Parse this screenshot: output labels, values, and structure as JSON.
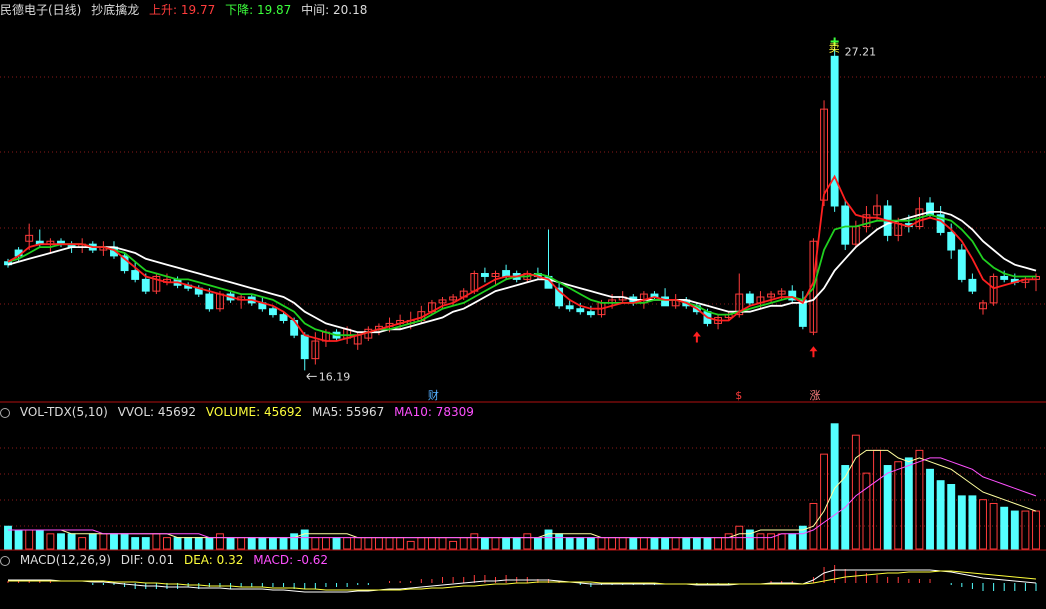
{
  "main_header": {
    "title": "民德电子(日线)",
    "indicator": "抄底擒龙",
    "up_label": "上升: 19.77",
    "down_label": "下降: 19.87",
    "mid_label": "中间: 20.18"
  },
  "vol_header": {
    "name": "VOL-TDX(5,10)",
    "vvol": "VVOL: 45692",
    "volume": "VOLUME: 45692",
    "ma5": "MA5: 55967",
    "ma10": "MA10: 78309"
  },
  "macd_header": {
    "name": "MACD(12,26,9)",
    "dif": "DIF: 0.01",
    "dea": "DEA: 0.32",
    "macd": "MACD: -0.62"
  },
  "annotations": {
    "high_price": "27.21",
    "low_price": "16.19",
    "sell_mark": "卖",
    "event_cai": "财",
    "event_s": "$",
    "event_zhang": "涨"
  },
  "colors": {
    "up": "#ff3c3c",
    "down": "#54ffff",
    "ma_red": "#ff2020",
    "ma_green": "#20d020",
    "ma_white": "#ffffff",
    "vol_ma5": "#ffffa0",
    "vol_ma10": "#ff50ff"
  },
  "chart_data": {
    "type": "candlestick",
    "ylim": [
      15.6,
      28.0
    ],
    "candles": [
      [
        19.9,
        20.0,
        19.7,
        19.8
      ],
      [
        20.3,
        20.4,
        19.9,
        20.1
      ],
      [
        20.6,
        21.2,
        20.3,
        20.8
      ],
      [
        20.6,
        21.0,
        20.4,
        20.5
      ],
      [
        20.5,
        20.7,
        20.2,
        20.6
      ],
      [
        20.6,
        20.7,
        20.4,
        20.5
      ],
      [
        20.5,
        20.6,
        20.2,
        20.4
      ],
      [
        20.4,
        20.7,
        20.2,
        20.5
      ],
      [
        20.5,
        20.6,
        20.2,
        20.3
      ],
      [
        20.3,
        20.6,
        20.1,
        20.4
      ],
      [
        20.4,
        20.6,
        20.0,
        20.1
      ],
      [
        20.1,
        20.2,
        19.5,
        19.6
      ],
      [
        19.6,
        19.9,
        19.2,
        19.3
      ],
      [
        19.3,
        19.5,
        18.8,
        18.9
      ],
      [
        18.9,
        19.5,
        18.8,
        19.4
      ],
      [
        19.2,
        19.5,
        19.1,
        19.3
      ],
      [
        19.3,
        19.4,
        19.0,
        19.1
      ],
      [
        19.1,
        19.2,
        18.9,
        19.0
      ],
      [
        19.0,
        19.1,
        18.7,
        18.8
      ],
      [
        18.8,
        19.0,
        18.2,
        18.3
      ],
      [
        18.3,
        18.9,
        18.2,
        18.8
      ],
      [
        18.8,
        18.9,
        18.5,
        18.6
      ],
      [
        18.6,
        18.8,
        18.3,
        18.7
      ],
      [
        18.7,
        18.8,
        18.4,
        18.5
      ],
      [
        18.5,
        18.7,
        18.2,
        18.3
      ],
      [
        18.3,
        18.4,
        18.0,
        18.1
      ],
      [
        18.1,
        18.2,
        17.8,
        17.9
      ],
      [
        17.9,
        18.0,
        17.3,
        17.4
      ],
      [
        17.4,
        17.5,
        16.2,
        16.6
      ],
      [
        16.6,
        17.5,
        16.4,
        17.2
      ],
      [
        17.2,
        17.6,
        17.0,
        17.5
      ],
      [
        17.5,
        17.6,
        17.2,
        17.3
      ],
      [
        17.3,
        17.7,
        17.1,
        17.6
      ],
      [
        17.1,
        17.5,
        16.9,
        17.4
      ],
      [
        17.3,
        17.7,
        17.2,
        17.6
      ],
      [
        17.6,
        17.8,
        17.4,
        17.7
      ],
      [
        17.7,
        18.0,
        17.5,
        17.8
      ],
      [
        17.8,
        18.1,
        17.6,
        17.9
      ],
      [
        17.8,
        18.2,
        17.6,
        17.9
      ],
      [
        17.9,
        18.4,
        17.8,
        18.2
      ],
      [
        18.2,
        18.6,
        18.1,
        18.5
      ],
      [
        18.5,
        18.7,
        18.3,
        18.6
      ],
      [
        18.6,
        18.8,
        18.4,
        18.7
      ],
      [
        18.7,
        19.0,
        18.6,
        18.9
      ],
      [
        18.9,
        19.6,
        18.8,
        19.5
      ],
      [
        19.5,
        19.7,
        19.2,
        19.4
      ],
      [
        19.4,
        19.6,
        19.1,
        19.5
      ],
      [
        19.6,
        19.8,
        19.3,
        19.4
      ],
      [
        19.5,
        19.6,
        19.2,
        19.3
      ],
      [
        19.3,
        19.6,
        19.2,
        19.5
      ],
      [
        19.5,
        19.7,
        19.3,
        19.4
      ],
      [
        19.4,
        21.0,
        19.3,
        19.0
      ],
      [
        19.0,
        19.2,
        18.3,
        18.4
      ],
      [
        18.4,
        18.6,
        18.2,
        18.3
      ],
      [
        18.3,
        18.5,
        18.1,
        18.2
      ],
      [
        18.2,
        18.4,
        18.0,
        18.1
      ],
      [
        18.1,
        18.6,
        18.0,
        18.5
      ],
      [
        18.5,
        18.8,
        18.3,
        18.6
      ],
      [
        18.6,
        18.9,
        18.5,
        18.7
      ],
      [
        18.7,
        18.8,
        18.4,
        18.5
      ],
      [
        18.5,
        18.9,
        18.3,
        18.8
      ],
      [
        18.8,
        18.9,
        18.6,
        18.7
      ],
      [
        18.7,
        19.0,
        18.5,
        18.4
      ],
      [
        18.4,
        18.8,
        18.3,
        18.6
      ],
      [
        18.6,
        18.7,
        18.3,
        18.4
      ],
      [
        18.4,
        18.5,
        18.1,
        18.2
      ],
      [
        18.2,
        18.3,
        17.7,
        17.8
      ],
      [
        17.8,
        18.1,
        17.6,
        18.0
      ],
      [
        18.0,
        18.2,
        17.9,
        18.1
      ],
      [
        18.1,
        19.5,
        18.0,
        18.8
      ],
      [
        18.8,
        18.9,
        18.4,
        18.5
      ],
      [
        18.5,
        18.9,
        18.3,
        18.7
      ],
      [
        18.7,
        18.9,
        18.5,
        18.8
      ],
      [
        18.8,
        19.0,
        18.6,
        18.9
      ],
      [
        18.9,
        19.1,
        18.5,
        18.6
      ],
      [
        18.6,
        18.9,
        17.6,
        17.7
      ],
      [
        17.5,
        20.7,
        17.4,
        20.6
      ],
      [
        22.0,
        25.4,
        21.8,
        25.1
      ],
      [
        26.9,
        27.2,
        21.6,
        21.8
      ],
      [
        21.8,
        22.0,
        20.3,
        20.5
      ],
      [
        20.5,
        21.3,
        20.4,
        21.1
      ],
      [
        21.1,
        21.8,
        20.9,
        21.5
      ],
      [
        21.5,
        22.2,
        21.3,
        21.8
      ],
      [
        21.8,
        22.0,
        20.6,
        20.8
      ],
      [
        20.8,
        21.4,
        20.6,
        21.2
      ],
      [
        21.2,
        21.5,
        20.9,
        21.1
      ],
      [
        21.1,
        22.1,
        21.0,
        21.7
      ],
      [
        21.9,
        22.1,
        21.4,
        21.5
      ],
      [
        21.5,
        21.8,
        20.8,
        20.9
      ],
      [
        20.9,
        21.2,
        20.0,
        20.3
      ],
      [
        20.3,
        20.5,
        19.2,
        19.3
      ],
      [
        19.3,
        19.5,
        18.8,
        18.9
      ],
      [
        18.3,
        18.6,
        18.1,
        18.5
      ],
      [
        18.5,
        19.5,
        18.4,
        19.4
      ],
      [
        19.4,
        19.6,
        19.2,
        19.3
      ],
      [
        19.3,
        19.5,
        19.1,
        19.2
      ],
      [
        19.2,
        19.4,
        19.0,
        19.3
      ],
      [
        19.3,
        19.5,
        18.9,
        19.4
      ]
    ],
    "ma_red": [
      19.9,
      20.1,
      20.4,
      20.5,
      20.5,
      20.5,
      20.5,
      20.5,
      20.4,
      20.4,
      20.3,
      20.0,
      19.7,
      19.4,
      19.3,
      19.2,
      19.2,
      19.1,
      19.0,
      18.9,
      18.8,
      18.7,
      18.6,
      18.6,
      18.5,
      18.4,
      18.2,
      17.9,
      17.4,
      17.3,
      17.2,
      17.2,
      17.3,
      17.4,
      17.5,
      17.6,
      17.7,
      17.8,
      17.9,
      18.0,
      18.2,
      18.4,
      18.5,
      18.7,
      18.9,
      19.1,
      19.3,
      19.4,
      19.4,
      19.5,
      19.4,
      19.3,
      18.9,
      18.6,
      18.4,
      18.3,
      18.3,
      18.4,
      18.5,
      18.5,
      18.6,
      18.7,
      18.6,
      18.6,
      18.5,
      18.3,
      18.0,
      17.9,
      17.9,
      18.2,
      18.4,
      18.5,
      18.6,
      18.7,
      18.7,
      18.5,
      19.2,
      22.2,
      22.8,
      22.0,
      21.5,
      21.4,
      21.4,
      21.3,
      21.2,
      21.1,
      21.3,
      21.4,
      21.3,
      21.0,
      20.6,
      20.0,
      19.3,
      19.0,
      19.1,
      19.2,
      19.3,
      19.3
    ],
    "ma_green": [
      19.9,
      20.0,
      20.2,
      20.4,
      20.4,
      20.5,
      20.5,
      20.5,
      20.4,
      20.4,
      20.3,
      20.2,
      19.9,
      19.6,
      19.5,
      19.4,
      19.3,
      19.3,
      19.2,
      19.1,
      19.0,
      18.9,
      18.8,
      18.8,
      18.7,
      18.6,
      18.4,
      18.2,
      17.8,
      17.6,
      17.5,
      17.4,
      17.4,
      17.4,
      17.5,
      17.6,
      17.6,
      17.7,
      17.8,
      17.9,
      18.1,
      18.3,
      18.4,
      18.5,
      18.7,
      18.9,
      19.1,
      19.3,
      19.4,
      19.4,
      19.5,
      19.4,
      19.2,
      19.0,
      18.8,
      18.6,
      18.5,
      18.5,
      18.5,
      18.5,
      18.5,
      18.6,
      18.6,
      18.6,
      18.5,
      18.4,
      18.2,
      18.1,
      18.1,
      18.2,
      18.3,
      18.4,
      18.5,
      18.6,
      18.7,
      18.6,
      19.0,
      20.3,
      21.0,
      21.1,
      21.1,
      21.2,
      21.3,
      21.3,
      21.3,
      21.3,
      21.4,
      21.5,
      21.4,
      21.3,
      21.0,
      20.6,
      20.0,
      19.7,
      19.5,
      19.4,
      19.4,
      19.4
    ],
    "ma_white": [
      19.8,
      19.9,
      20.0,
      20.1,
      20.2,
      20.3,
      20.4,
      20.4,
      20.4,
      20.4,
      20.4,
      20.3,
      20.2,
      20.0,
      19.9,
      19.8,
      19.7,
      19.6,
      19.5,
      19.4,
      19.3,
      19.2,
      19.1,
      19.0,
      18.9,
      18.8,
      18.7,
      18.5,
      18.2,
      18.0,
      17.8,
      17.7,
      17.6,
      17.5,
      17.5,
      17.5,
      17.6,
      17.6,
      17.7,
      17.8,
      17.9,
      18.0,
      18.2,
      18.3,
      18.5,
      18.7,
      18.9,
      19.0,
      19.1,
      19.2,
      19.3,
      19.3,
      19.2,
      19.1,
      19.0,
      18.9,
      18.8,
      18.7,
      18.7,
      18.6,
      18.6,
      18.6,
      18.6,
      18.6,
      18.6,
      18.5,
      18.4,
      18.3,
      18.2,
      18.2,
      18.2,
      18.3,
      18.4,
      18.4,
      18.5,
      18.5,
      18.6,
      19.0,
      19.6,
      20.0,
      20.4,
      20.7,
      21.0,
      21.2,
      21.3,
      21.4,
      21.5,
      21.6,
      21.6,
      21.5,
      21.3,
      21.0,
      20.6,
      20.3,
      20.0,
      19.8,
      19.7,
      19.6
    ],
    "volume": [
      6,
      5,
      5,
      5,
      4,
      4,
      4,
      3,
      4,
      4,
      4,
      4,
      3,
      3,
      4,
      3,
      3,
      3,
      3,
      3,
      4,
      3,
      3,
      3,
      3,
      3,
      3,
      4,
      5,
      3,
      3,
      3,
      3,
      3,
      3,
      3,
      3,
      3,
      2,
      3,
      3,
      3,
      2,
      3,
      4,
      3,
      3,
      3,
      3,
      4,
      3,
      5,
      4,
      3,
      3,
      3,
      3,
      3,
      3,
      3,
      3,
      3,
      3,
      3,
      3,
      3,
      3,
      3,
      4,
      6,
      5,
      4,
      4,
      4,
      4,
      6,
      12,
      25,
      33,
      22,
      30,
      20,
      26,
      22,
      23,
      24,
      26,
      21,
      18,
      17,
      14,
      14,
      13,
      12,
      11,
      10,
      10,
      10
    ],
    "vol_ma5": [
      5,
      5,
      5,
      5,
      5,
      5,
      4,
      4,
      4,
      4,
      4,
      4,
      4,
      4,
      4,
      4,
      3,
      3,
      3,
      3,
      3,
      3,
      3,
      3,
      3,
      3,
      3,
      3,
      4,
      4,
      4,
      4,
      4,
      3,
      3,
      3,
      3,
      3,
      3,
      3,
      3,
      3,
      3,
      3,
      3,
      3,
      3,
      3,
      3,
      3,
      3,
      4,
      4,
      4,
      4,
      4,
      3,
      3,
      3,
      3,
      3,
      3,
      3,
      3,
      3,
      3,
      3,
      3,
      3,
      4,
      4,
      5,
      5,
      5,
      5,
      5,
      6,
      10,
      16,
      19,
      24,
      26,
      26,
      26,
      24,
      23,
      24,
      23,
      22,
      21,
      19,
      17,
      15,
      14,
      13,
      12,
      11,
      10
    ],
    "vol_ma10": [
      5,
      5,
      5,
      5,
      5,
      5,
      5,
      5,
      5,
      4,
      4,
      4,
      4,
      4,
      4,
      4,
      4,
      4,
      4,
      3,
      3,
      3,
      3,
      3,
      3,
      3,
      3,
      3,
      3,
      3,
      3,
      3,
      3,
      3,
      3,
      3,
      3,
      3,
      3,
      3,
      3,
      3,
      3,
      3,
      3,
      3,
      3,
      3,
      3,
      3,
      3,
      3,
      3,
      3,
      3,
      3,
      3,
      3,
      3,
      3,
      3,
      3,
      3,
      3,
      3,
      3,
      3,
      3,
      3,
      3,
      3,
      3,
      3,
      4,
      4,
      4,
      5,
      7,
      9,
      11,
      14,
      16,
      18,
      20,
      21,
      22,
      23,
      24,
      24,
      23,
      22,
      21,
      19,
      18,
      17,
      16,
      15,
      14
    ],
    "macd_dif": [
      0.3,
      0.3,
      0.3,
      0.3,
      0.3,
      0.2,
      0.2,
      0.2,
      0.1,
      0.1,
      0.0,
      -0.1,
      -0.2,
      -0.3,
      -0.3,
      -0.4,
      -0.4,
      -0.4,
      -0.5,
      -0.5,
      -0.5,
      -0.6,
      -0.6,
      -0.6,
      -0.6,
      -0.7,
      -0.7,
      -0.8,
      -0.9,
      -0.9,
      -0.9,
      -0.9,
      -0.9,
      -0.8,
      -0.8,
      -0.7,
      -0.6,
      -0.6,
      -0.5,
      -0.4,
      -0.3,
      -0.2,
      -0.1,
      0.0,
      0.1,
      0.2,
      0.2,
      0.3,
      0.3,
      0.3,
      0.3,
      0.3,
      0.2,
      0.1,
      0.0,
      -0.1,
      -0.1,
      -0.1,
      -0.1,
      -0.1,
      -0.1,
      -0.1,
      -0.1,
      -0.1,
      -0.1,
      -0.2,
      -0.2,
      -0.2,
      -0.2,
      -0.1,
      -0.1,
      -0.1,
      0.0,
      0.0,
      0.0,
      -0.1,
      0.3,
      1.0,
      1.3,
      1.3,
      1.3,
      1.3,
      1.3,
      1.3,
      1.3,
      1.3,
      1.3,
      1.3,
      1.2,
      1.1,
      0.9,
      0.7,
      0.5,
      0.4,
      0.3,
      0.2,
      0.1,
      0.0
    ],
    "macd_dea": [
      0.2,
      0.2,
      0.2,
      0.2,
      0.2,
      0.2,
      0.2,
      0.2,
      0.2,
      0.2,
      0.1,
      0.1,
      0.1,
      0.0,
      0.0,
      -0.1,
      -0.1,
      -0.2,
      -0.2,
      -0.3,
      -0.3,
      -0.3,
      -0.4,
      -0.4,
      -0.4,
      -0.5,
      -0.5,
      -0.5,
      -0.6,
      -0.6,
      -0.7,
      -0.7,
      -0.7,
      -0.7,
      -0.7,
      -0.7,
      -0.7,
      -0.7,
      -0.6,
      -0.6,
      -0.5,
      -0.5,
      -0.4,
      -0.3,
      -0.3,
      -0.2,
      -0.1,
      -0.1,
      0.0,
      0.0,
      0.1,
      0.1,
      0.1,
      0.1,
      0.1,
      0.1,
      0.0,
      0.0,
      0.0,
      0.0,
      0.0,
      0.0,
      -0.1,
      -0.1,
      -0.1,
      -0.1,
      -0.1,
      -0.1,
      -0.1,
      -0.1,
      -0.1,
      -0.1,
      -0.1,
      -0.1,
      -0.1,
      -0.1,
      0.0,
      0.2,
      0.4,
      0.6,
      0.7,
      0.8,
      0.9,
      1.0,
      1.0,
      1.1,
      1.1,
      1.1,
      1.2,
      1.2,
      1.1,
      1.0,
      0.9,
      0.8,
      0.7,
      0.6,
      0.5,
      0.4
    ]
  }
}
